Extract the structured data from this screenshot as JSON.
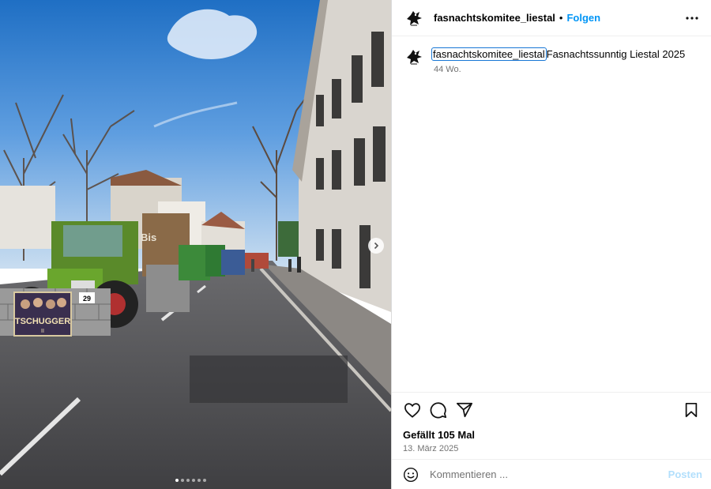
{
  "post": {
    "username": "fasnachtskomitee_liestal",
    "follow_label": "Folgen",
    "separator": "•"
  },
  "caption": {
    "username": "fasnachtskomitee_liestal",
    "text": "Fasnachtssunntig Liestal 2025",
    "time_ago": "44 Wo."
  },
  "engagement": {
    "likes": "Gefällt 105 Mal",
    "date": "13. März 2025"
  },
  "comment": {
    "placeholder": "Kommentieren ...",
    "post_label": "Posten"
  },
  "photo": {
    "float_sign": "TSCHUGGER",
    "float_sign_sub": "II",
    "number_plate": "29",
    "wall_text": "Bis"
  },
  "carousel": {
    "total": 6,
    "active": 1
  },
  "icons": {
    "avatar": "masked-figure-logo",
    "more": "ellipsis-icon",
    "like": "heart-icon",
    "comment": "comment-bubble-icon",
    "share": "paper-plane-icon",
    "save": "bookmark-icon",
    "emoji": "smiley-icon",
    "next": "chevron-right-icon"
  },
  "colors": {
    "link_blue": "#0095f6",
    "post_disabled": "#b2dffc",
    "secondary_text": "#737373"
  }
}
